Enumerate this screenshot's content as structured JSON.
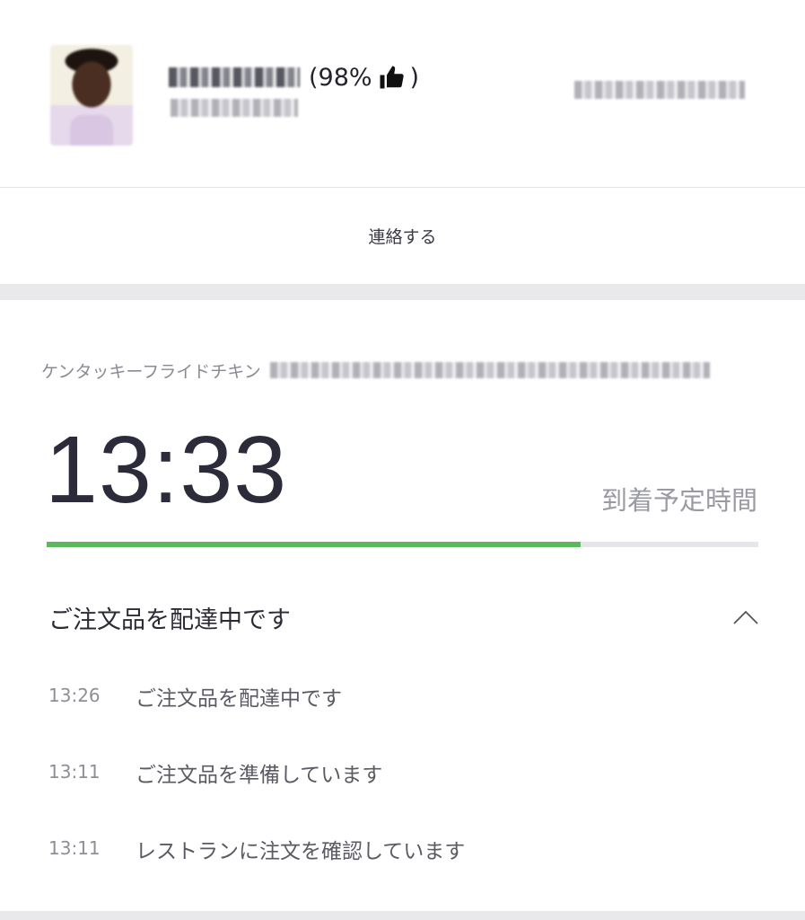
{
  "driver": {
    "rating_text": "(98%",
    "rating_close": ")",
    "thumb_icon": "thumbs-up-icon"
  },
  "contact": {
    "label": "連絡する"
  },
  "order": {
    "restaurant": "ケンタッキーフライドチキン",
    "eta_time": "13:33",
    "eta_label": "到着予定時間",
    "progress_fraction": 0.75,
    "progress_color": "#5cb85c",
    "status_title": "ご注文品を配達中です",
    "timeline": [
      {
        "time": "13:26",
        "text": "ご注文品を配達中です"
      },
      {
        "time": "13:11",
        "text": "ご注文品を準備しています"
      },
      {
        "time": "13:11",
        "text": "レストランに注文を確認しています"
      }
    ]
  }
}
